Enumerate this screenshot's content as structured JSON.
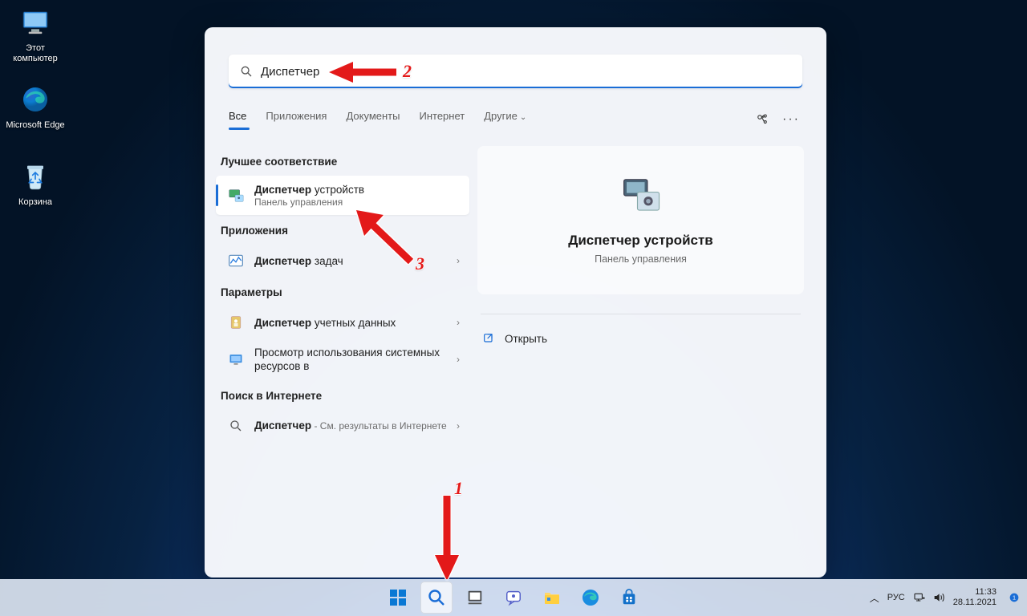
{
  "desktop": {
    "icons": [
      {
        "label": "Этот компьютер"
      },
      {
        "label": "Microsoft Edge"
      },
      {
        "label": "Корзина"
      }
    ]
  },
  "search": {
    "query": "Диспетчер",
    "tabs": {
      "all": "Все",
      "apps": "Приложения",
      "docs": "Документы",
      "web": "Интернет",
      "more": "Другие"
    },
    "sections": {
      "best": "Лучшее соответствие",
      "apps": "Приложения",
      "settings": "Параметры",
      "web": "Поиск в Интернете"
    },
    "results": {
      "devmgr_bold": "Диспетчер",
      "devmgr_rest": " устройств",
      "devmgr_sub": "Панель управления",
      "taskmgr_bold": "Диспетчер",
      "taskmgr_rest": " задач",
      "credmgr_bold": "Диспетчер",
      "credmgr_rest": " учетных данных",
      "resmon": "Просмотр использования системных ресурсов в",
      "web_bold": "Диспетчер",
      "web_rest": " - См. результаты в Интернете"
    },
    "preview": {
      "title": "Диспетчер устройств",
      "sub": "Панель управления",
      "open": "Открыть"
    }
  },
  "taskbar": {
    "lang": "РУС",
    "time": "11:33",
    "date": "28.11.2021"
  },
  "annotations": {
    "n1": "1",
    "n2": "2",
    "n3": "3"
  },
  "colors": {
    "accent": "#1a6dd6",
    "arrow": "#e31919"
  }
}
